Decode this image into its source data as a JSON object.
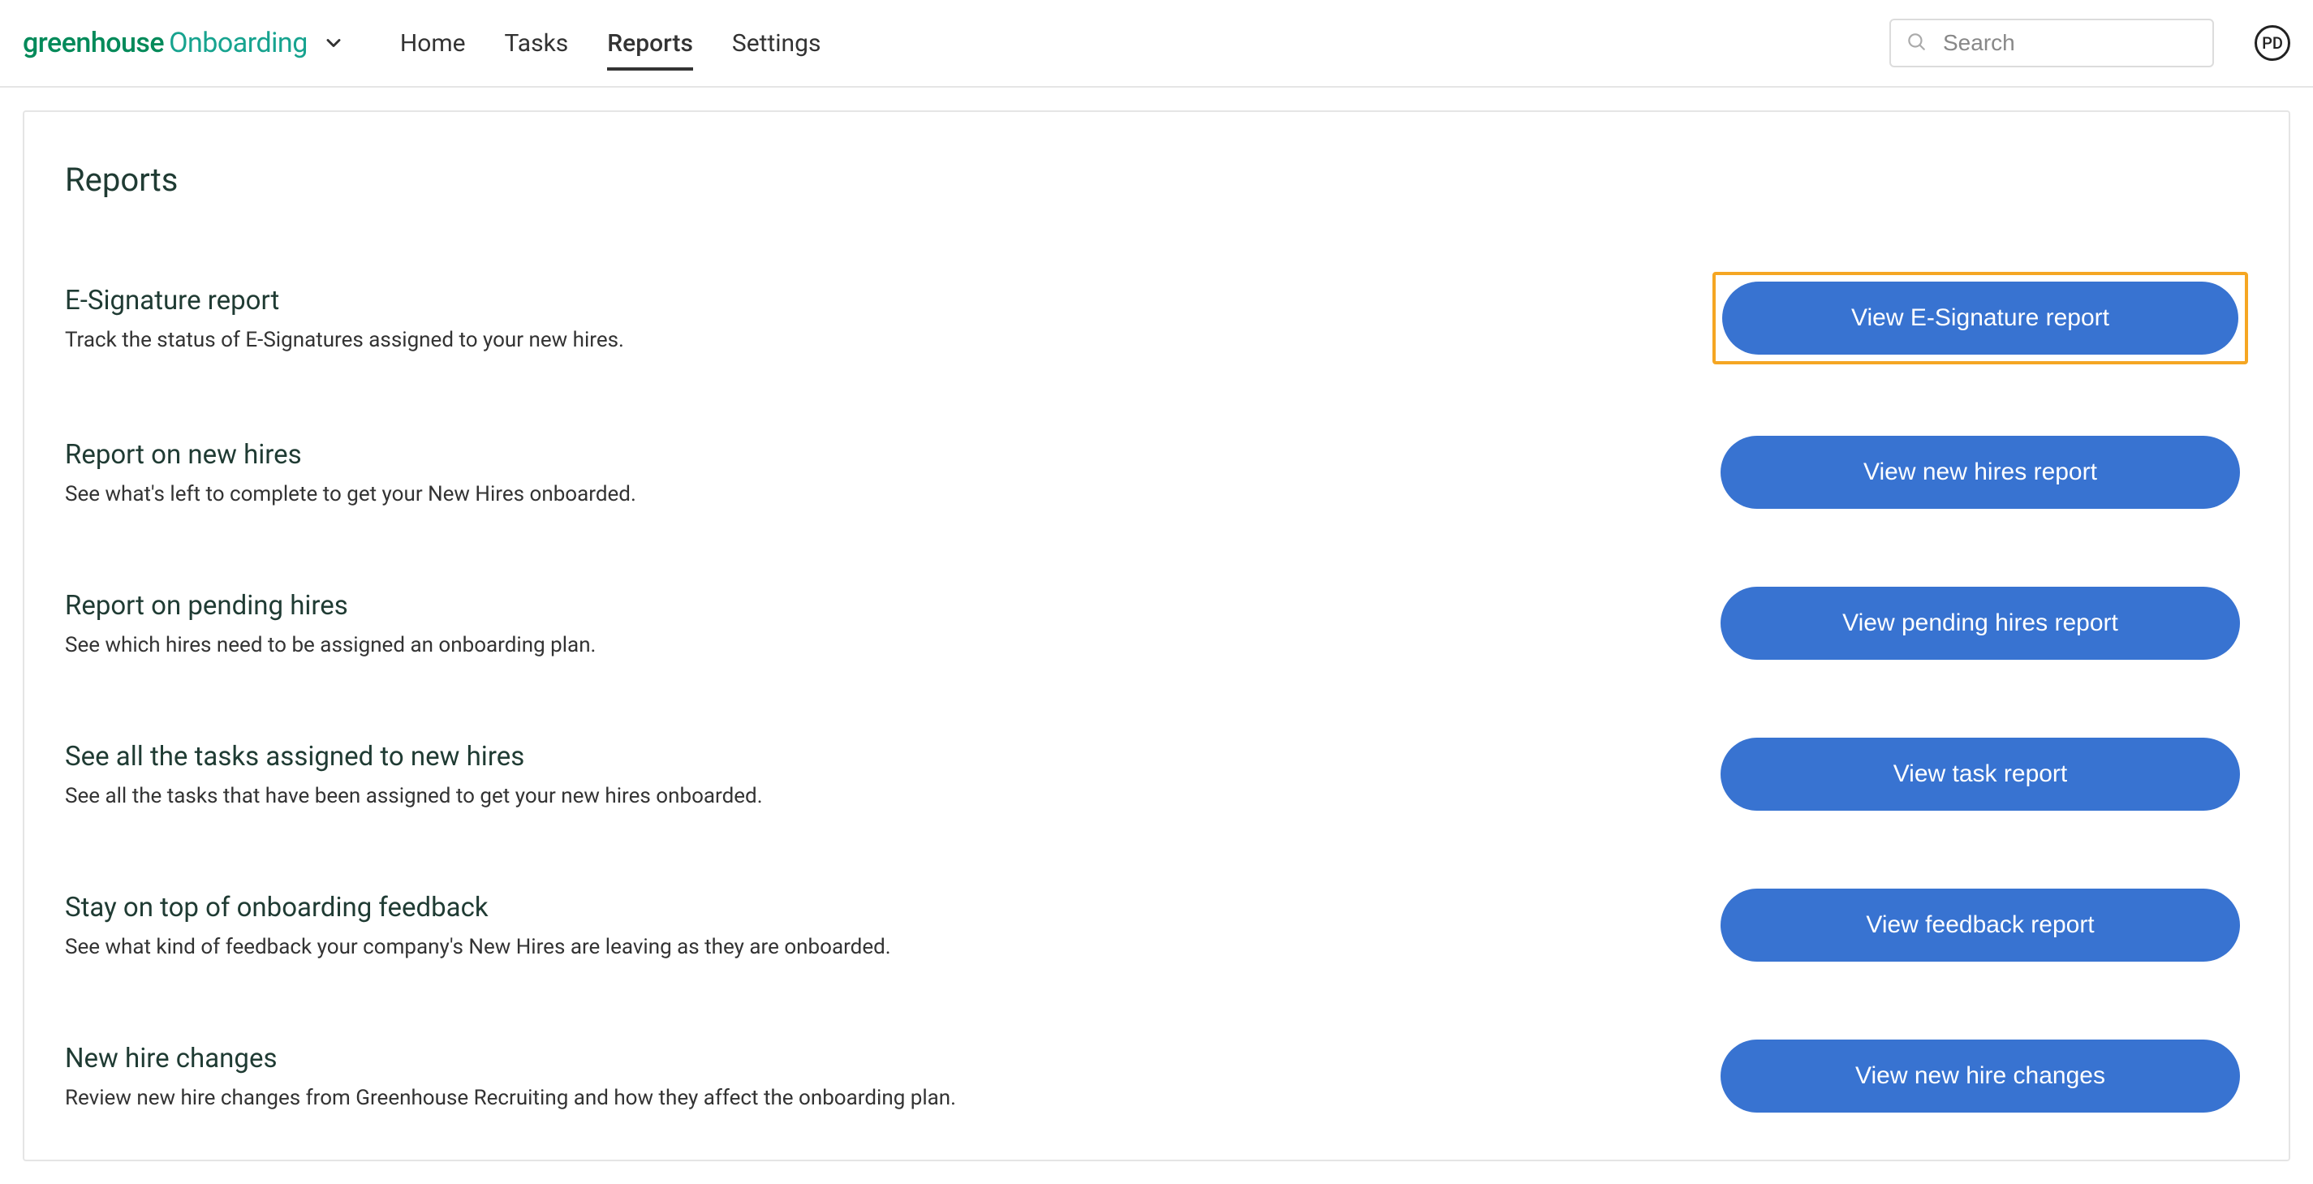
{
  "brand": {
    "text1": "greenhouse",
    "text2": "Onboarding"
  },
  "nav": {
    "home": "Home",
    "tasks": "Tasks",
    "reports": "Reports",
    "settings": "Settings"
  },
  "search": {
    "placeholder": "Search"
  },
  "avatar": {
    "initials": "PD"
  },
  "page": {
    "title": "Reports"
  },
  "reports": [
    {
      "title": "E-Signature report",
      "desc": "Track the status of E-Signatures assigned to your new hires.",
      "button": "View E-Signature report",
      "highlighted": true
    },
    {
      "title": "Report on new hires",
      "desc": "See what's left to complete to get your New Hires onboarded.",
      "button": "View new hires report",
      "highlighted": false
    },
    {
      "title": "Report on pending hires",
      "desc": "See which hires need to be assigned an onboarding plan.",
      "button": "View pending hires report",
      "highlighted": false
    },
    {
      "title": "See all the tasks assigned to new hires",
      "desc": "See all the tasks that have been assigned to get your new hires onboarded.",
      "button": "View task report",
      "highlighted": false
    },
    {
      "title": "Stay on top of onboarding feedback",
      "desc": "See what kind of feedback your company's New Hires are leaving as they are onboarded.",
      "button": "View feedback report",
      "highlighted": false
    },
    {
      "title": "New hire changes",
      "desc": "Review new hire changes from Greenhouse Recruiting and how they affect the onboarding plan.",
      "button": "View new hire changes",
      "highlighted": false
    }
  ]
}
